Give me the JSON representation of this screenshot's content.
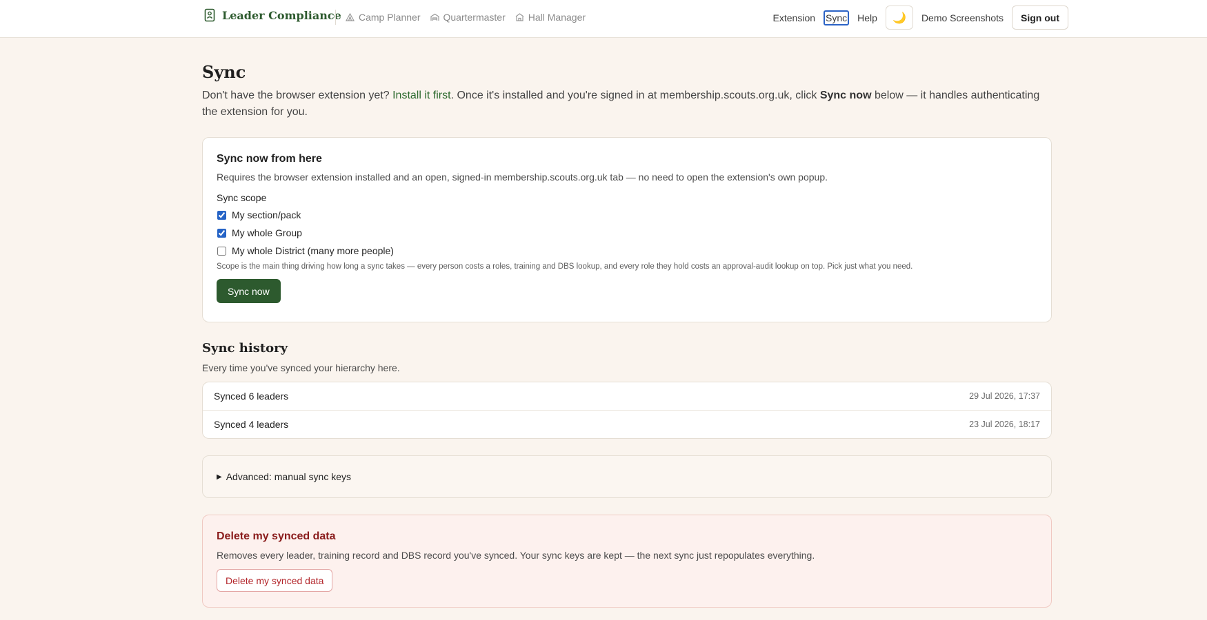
{
  "header": {
    "brand": "Leader Compliance",
    "apps": [
      {
        "label": "Camp Planner",
        "icon": "tent-icon"
      },
      {
        "label": "Quartermaster",
        "icon": "warehouse-icon"
      },
      {
        "label": "Hall Manager",
        "icon": "hall-icon"
      }
    ],
    "nav": {
      "extension": "Extension",
      "sync": "Sync",
      "help": "Help",
      "theme_icon": "🌙",
      "demo": "Demo Screenshots",
      "signout": "Sign out"
    }
  },
  "page": {
    "title": "Sync",
    "intro_before": "Don't have the browser extension yet? ",
    "intro_link": "Install it first",
    "intro_middle": ". Once it's installed and you're signed in at membership.scouts.org.uk, click ",
    "intro_bold": "Sync now",
    "intro_after": " below — it handles authenticating the extension for you."
  },
  "sync_card": {
    "title": "Sync now from here",
    "description": "Requires the browser extension installed and an open, signed-in membership.scouts.org.uk tab — no need to open the extension's own popup.",
    "scope_label": "Sync scope",
    "scopes": [
      {
        "label": "My section/pack",
        "checked": true
      },
      {
        "label": "My whole Group",
        "checked": true
      },
      {
        "label": "My whole District (many more people)",
        "checked": false
      }
    ],
    "help": "Scope is the main thing driving how long a sync takes — every person costs a roles, training and DBS lookup, and every role they hold costs an approval-audit lookup on top. Pick just what you need.",
    "button": "Sync now"
  },
  "history": {
    "title": "Sync history",
    "description": "Every time you've synced your hierarchy here.",
    "rows": [
      {
        "label": "Synced 6 leaders",
        "time": "29 Jul 2026, 17:37"
      },
      {
        "label": "Synced 4 leaders",
        "time": "23 Jul 2026, 18:17"
      }
    ]
  },
  "advanced": {
    "label": "Advanced: manual sync keys"
  },
  "danger": {
    "title": "Delete my synced data",
    "description": "Removes every leader, training record and DBS record you've synced. Your sync keys are kept — the next sync just repopulates everything.",
    "button": "Delete my synced data"
  },
  "colors": {
    "brand_green": "#2d5a2e",
    "background": "#faf4ee",
    "danger": "#b3262b",
    "focus": "#2b63c6"
  }
}
